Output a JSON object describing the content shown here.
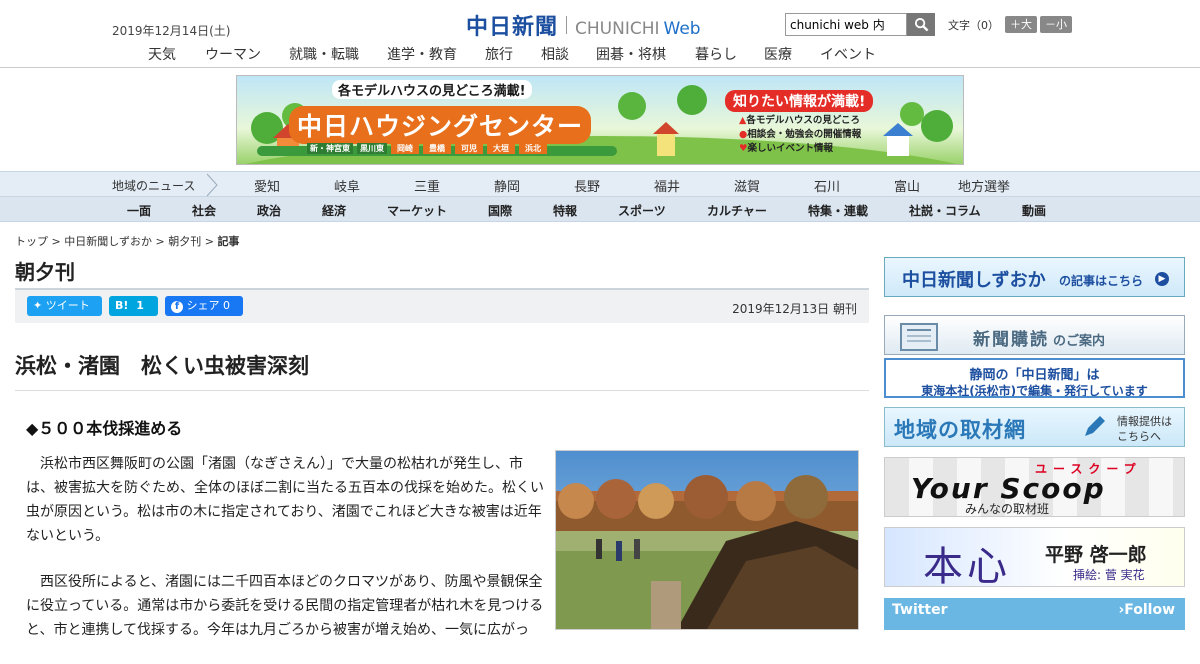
{
  "header": {
    "date": "2019年12月14日(土)",
    "logo_jp": "中日新聞",
    "logo_en": "CHUNICHI",
    "logo_web": "Web",
    "search_value": "chunichi web 内",
    "font_label": "文字（0）",
    "font_larger": "＋大",
    "font_smaller": "－小"
  },
  "subnav": [
    "天気",
    "ウーマン",
    "就職・転職",
    "進学・教育",
    "旅行",
    "相談",
    "囲碁・将棋",
    "暮らし",
    "医療",
    "イベント"
  ],
  "banner": {
    "top_text": "各モデルハウスの見どころ満載!",
    "main_text": "中日ハウジングセンター",
    "right_title": "知りたい情報が満載!",
    "right_items": [
      "各モデルハウスの見どころ",
      "相談会・勉強会の開催情報",
      "楽しいイベント情報"
    ],
    "locations": [
      "新・神宮東",
      "黒川東",
      "岡崎",
      "豊橋",
      "可児",
      "大垣",
      "浜北"
    ]
  },
  "region_nav": {
    "label": "地域のニュース",
    "items": [
      "愛知",
      "岐阜",
      "三重",
      "静岡",
      "長野",
      "福井",
      "滋賀",
      "石川",
      "富山",
      "地方選挙"
    ]
  },
  "category_nav": [
    "一面",
    "社会",
    "政治",
    "経済",
    "マーケット",
    "国際",
    "特報",
    "スポーツ",
    "カルチャー",
    "特集・連載",
    "社説・コラム",
    "動画"
  ],
  "breadcrumb": [
    "トップ",
    "中日新聞しずおか",
    "朝夕刊",
    "記事"
  ],
  "section_title": "朝夕刊",
  "share": {
    "tweet": "ツイート",
    "hatena": "B!",
    "hatena_count": "1",
    "facebook": "シェア",
    "facebook_count": "0"
  },
  "pub_date": "2019年12月13日 朝刊",
  "article": {
    "headline": "浜松・渚園　松くい虫被害深刻",
    "subhead": "◆５００本伐採進める",
    "paragraphs": [
      "浜松市西区舞阪町の公園「渚園（なぎさえん）」で大量の松枯れが発生し、市は、被害拡大を防ぐため、全体のほぼ二割に当たる五百本の伐採を始めた。松くい虫が原因という。松は市の木に指定されており、渚園でこれほど大きな被害は近年ないという。",
      "西区役所によると、渚園には二千四百本ほどのクロマツがあり、防風や景観保全に役立っている。通常は市から委託を受ける民間の指定管理者が枯れ木を見つけると、市と連携して伐採する。今年は九月ごろから被害が増え始め、一気に広がっ"
    ]
  },
  "sidebar": {
    "shizuoka_link": "中日新聞しずおか",
    "shizuoka_suffix": "の記事はこちら",
    "subscribe_main": "新聞購読",
    "subscribe_suffix": "のご案内",
    "hq_line1": "静岡の「中日新聞」は",
    "hq_line2": "東海本社(浜松市)で編集・発行しています",
    "network_main": "地域の取材網",
    "network_sub1": "情報提供は",
    "network_sub2": "こちらへ",
    "yourscoop_main": "Your Scoop",
    "yourscoop_kana": "ユースクープ",
    "yourscoop_sub": "みんなの取材班",
    "honshin_main": "本心",
    "honshin_author": "平野 啓一郎",
    "honshin_illust": "挿絵: 菅 実花",
    "twitter": "Twitter",
    "follow": "Follow"
  },
  "colors": {
    "brand_blue": "#1d4fa0",
    "twitter": "#1da1f2",
    "hatena": "#00a4de",
    "facebook": "#1877f2"
  }
}
